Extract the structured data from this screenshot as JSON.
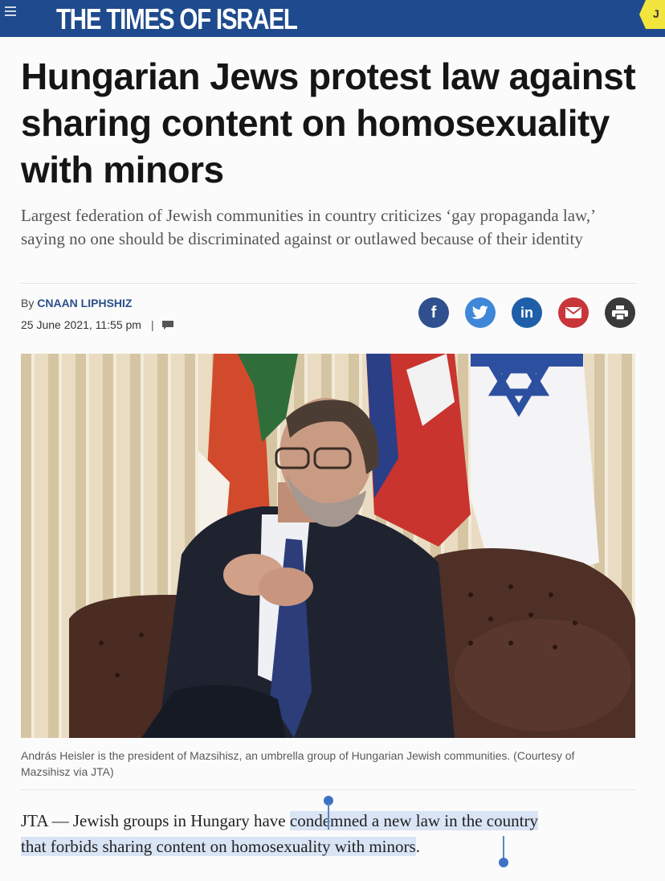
{
  "header": {
    "masthead": "THE TIMES OF ISRAEL",
    "edge_tab_text": "J",
    "menu_icon": "hamburger-icon",
    "bg_color": "#1f4a8d",
    "tab_color": "#f2e53d"
  },
  "article": {
    "headline": "Hungarian Jews protest law against sharing content on homosexuality with minors",
    "subhead": "Largest federation of Jewish communities in country criticizes ‘gay propaganda law,’ saying no one should be discriminated against or outlawed because of their identity",
    "byline_prefix": "By",
    "author": "CNAAN LIPHSHIZ",
    "date": "25 June 2021, 11:55 pm",
    "date_separator": "|",
    "caption": "András Heisler is the president of Mazsihisz, an umbrella group of Hungarian Jewish communities. (Courtesy of Mazsihisz via JTA)",
    "body_before": "JTA — Jewish groups in Hungary have ",
    "body_highlight_1": "condemned a new law in the country",
    "body_highlight_2": "that forbids sharing content on homosexuality with minors",
    "body_end": "."
  },
  "share": [
    {
      "name": "facebook",
      "label": "f",
      "icon": "facebook-icon",
      "color": "#2f4f8f"
    },
    {
      "name": "twitter",
      "label": "",
      "icon": "twitter-bird-icon",
      "color": "#3f87d8"
    },
    {
      "name": "linkedin",
      "label": "in",
      "icon": "linkedin-icon",
      "color": "#1f5faa"
    },
    {
      "name": "email",
      "label": "",
      "icon": "envelope-icon",
      "color": "#c8363a"
    },
    {
      "name": "print",
      "label": "",
      "icon": "printer-icon",
      "color": "#3a3a3a"
    }
  ],
  "selection_color": "#d9e4f5"
}
